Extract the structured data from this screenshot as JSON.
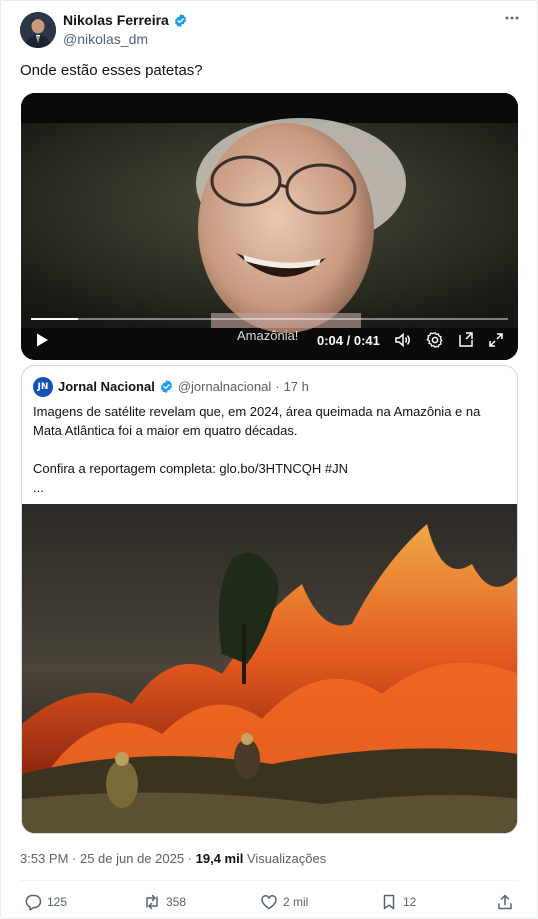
{
  "author": {
    "name": "Nikolas Ferreira",
    "handle": "@nikolas_dm"
  },
  "more_icon": "more-horizontal-icon",
  "tweet_text": "Onde estão esses patetas?",
  "video": {
    "caption": "Amazônia!",
    "time": "0:04 / 0:41",
    "progress": 0.0976,
    "controls": [
      "play-icon",
      "volume-icon",
      "settings-icon",
      "picture-in-picture-icon",
      "fullscreen-icon"
    ]
  },
  "quoted_tweet": {
    "avatar_text": "JN",
    "name": "Jornal Nacional",
    "handle": "@jornalnacional",
    "separator": "·",
    "time": "17 h",
    "text_line1": "Imagens de satélite revelam que, em 2024, área queimada na Amazônia e na Mata Atlântica foi a maior em quatro décadas.",
    "text_line2": "Confira a reportagem completa: glo.bo/3HTNCQH #JN",
    "text_line3": "..."
  },
  "meta": {
    "timestamp": "3:53 PM · 25 de jun de 2025 ·",
    "views_count": "19,4 mil",
    "views_label": "Visualizações"
  },
  "actions": {
    "replies": "125",
    "reposts": "358",
    "likes": "2 mil",
    "bookmarks": "12"
  },
  "colors": {
    "verified": "#1d9bf0",
    "secondary_text": "#536471",
    "border": "#cfd9de"
  }
}
